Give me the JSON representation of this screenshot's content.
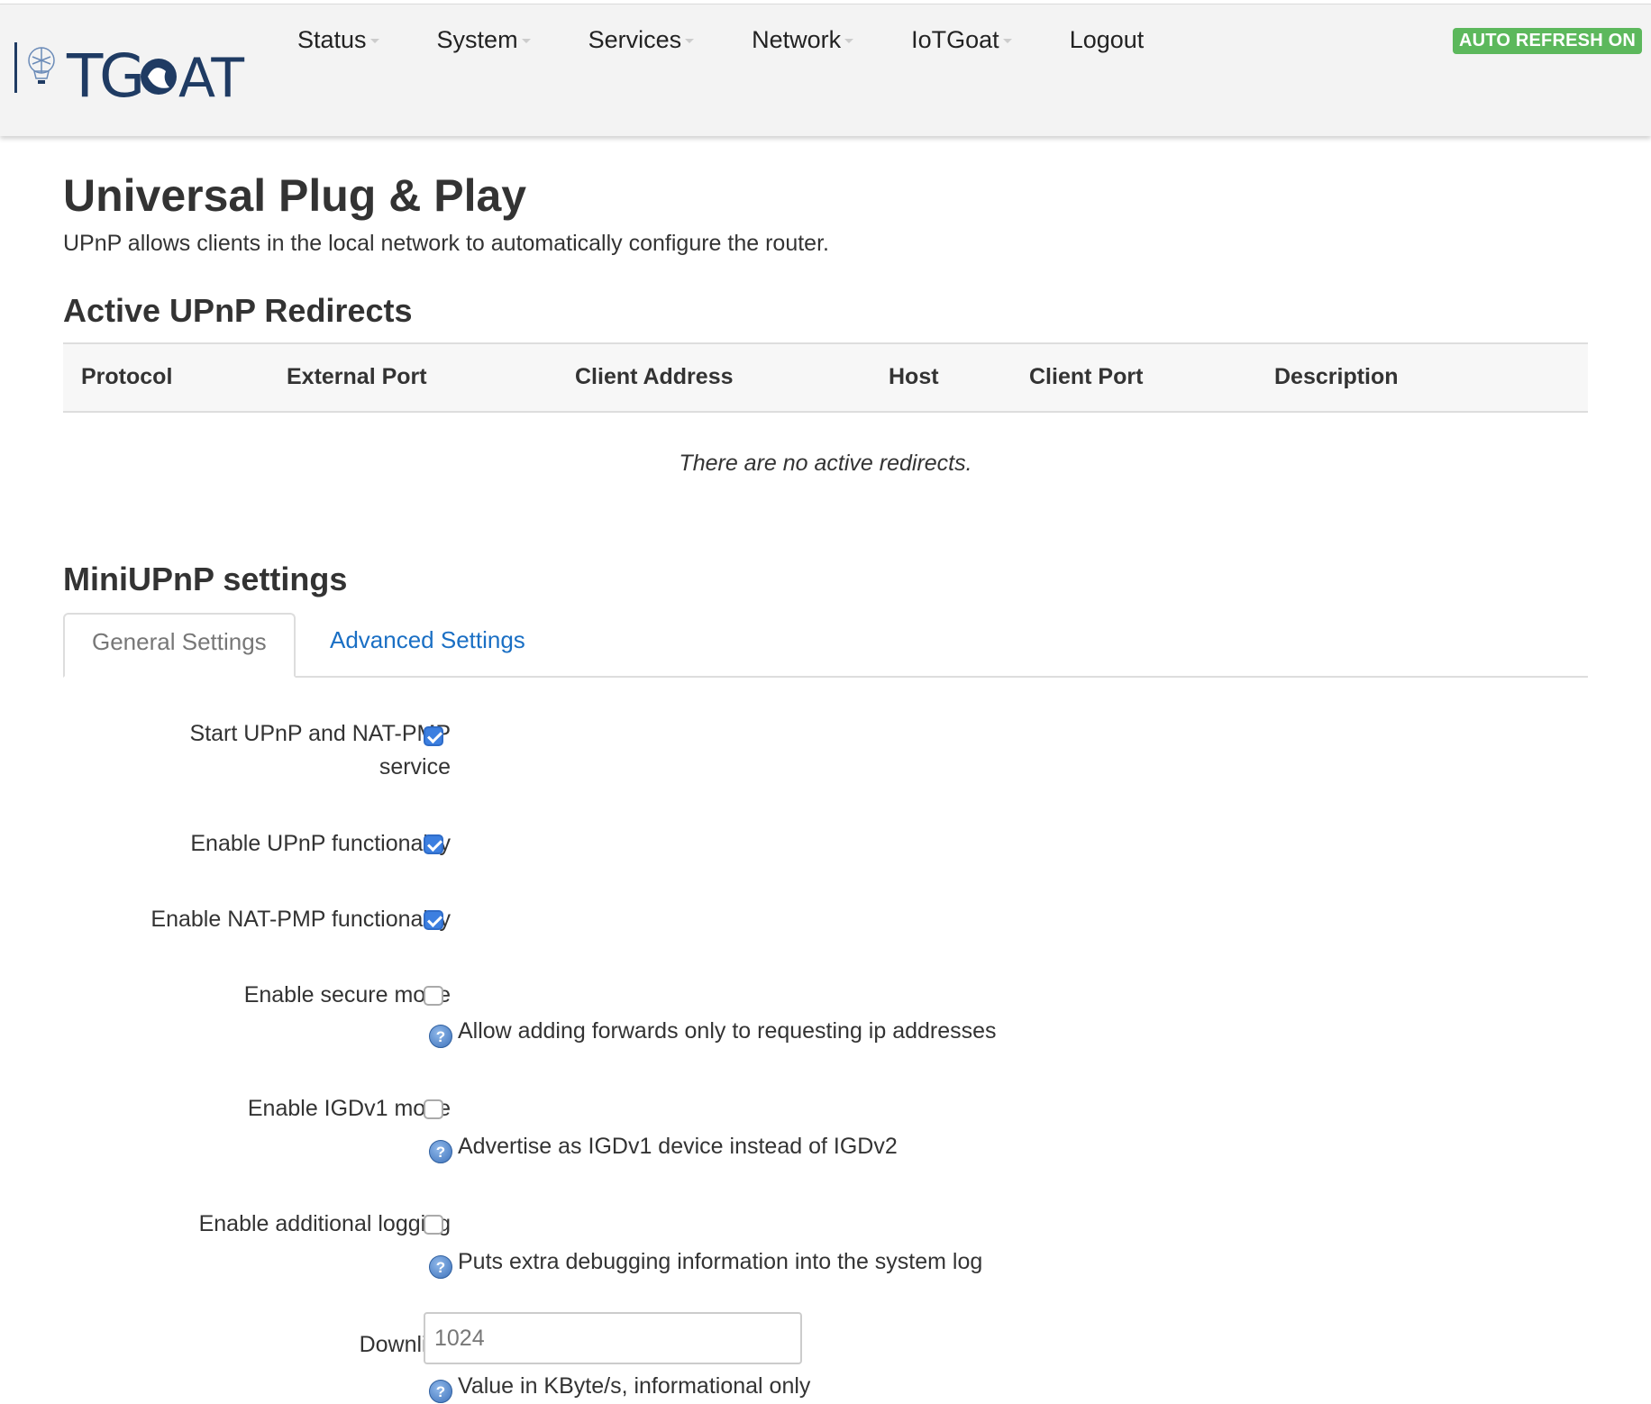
{
  "header": {
    "logo_text": "IoTGOAT",
    "nav": [
      {
        "label": "Status",
        "caret": true
      },
      {
        "label": "System",
        "caret": true
      },
      {
        "label": "Services",
        "caret": true
      },
      {
        "label": "Network",
        "caret": true
      },
      {
        "label": "IoTGoat",
        "caret": true
      },
      {
        "label": "Logout",
        "caret": false
      }
    ],
    "badge": "AUTO REFRESH ON",
    "badge_color": "#5cb85c"
  },
  "page": {
    "title": "Universal Plug & Play",
    "subtitle": "UPnP allows clients in the local network to automatically configure the router."
  },
  "redirects": {
    "title": "Active UPnP Redirects",
    "columns": [
      "Protocol",
      "External Port",
      "Client Address",
      "Host",
      "Client Port",
      "Description"
    ],
    "empty_text": "There are no active redirects."
  },
  "settings": {
    "title": "MiniUPnP settings",
    "tabs": [
      {
        "label": "General Settings",
        "active": true
      },
      {
        "label": "Advanced Settings",
        "active": false
      }
    ],
    "fields": {
      "start_service": {
        "label": "Start UPnP and NAT-PMP service",
        "checked": true
      },
      "enable_upnp": {
        "label": "Enable UPnP functionality",
        "checked": true
      },
      "enable_natpmp": {
        "label": "Enable NAT-PMP functionality",
        "checked": true
      },
      "secure_mode": {
        "label": "Enable secure mode",
        "checked": false,
        "help": "Allow adding forwards only to requesting ip addresses"
      },
      "igdv1": {
        "label": "Enable IGDv1 mode",
        "checked": false,
        "help": "Advertise as IGDv1 device instead of IGDv2"
      },
      "logging": {
        "label": "Enable additional logging",
        "checked": false,
        "help": "Puts extra debugging information into the system log"
      },
      "downlink": {
        "label": "Downlink",
        "placeholder": "1024",
        "help": "Value in KByte/s, informational only"
      }
    },
    "accent_color": "#3c7fe0",
    "link_color": "#1a6fc4"
  }
}
